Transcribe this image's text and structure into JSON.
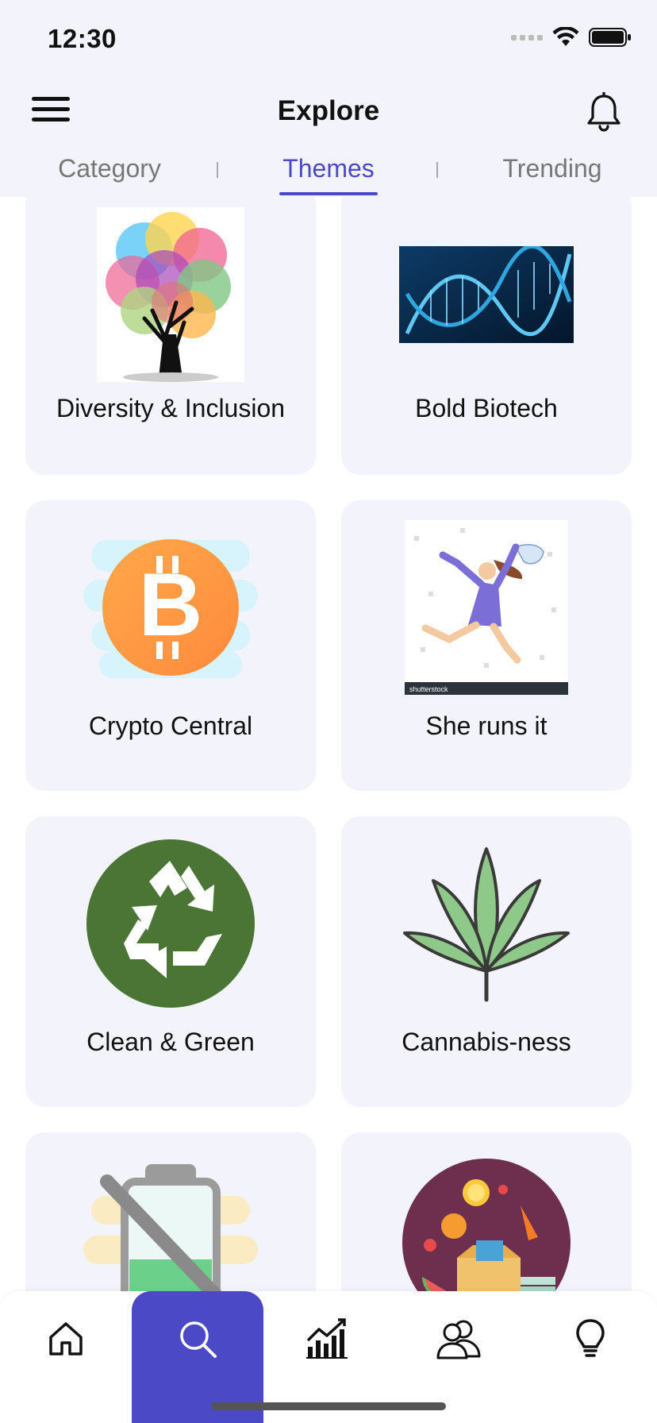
{
  "status_bar": {
    "time": "12:30"
  },
  "header": {
    "title": "Explore"
  },
  "tabs": [
    {
      "label": "Category",
      "active": false
    },
    {
      "label": "Themes",
      "active": true
    },
    {
      "label": "Trending",
      "active": false
    }
  ],
  "themes": [
    {
      "label": "Diversity & Inclusion",
      "icon": "fingerprint-tree"
    },
    {
      "label": "Bold Biotech",
      "icon": "dna-helix"
    },
    {
      "label": "Crypto Central",
      "icon": "bitcoin-coin"
    },
    {
      "label": "She runs it",
      "icon": "running-woman"
    },
    {
      "label": "Clean & Green",
      "icon": "recycle-symbol"
    },
    {
      "label": "Cannabis-ness",
      "icon": "cannabis-leaf"
    },
    {
      "label": "",
      "icon": "low-battery"
    },
    {
      "label": "",
      "icon": "food-box"
    }
  ],
  "bottom_nav": [
    {
      "icon": "home-icon",
      "active": false
    },
    {
      "icon": "search-icon",
      "active": true
    },
    {
      "icon": "chart-icon",
      "active": false
    },
    {
      "icon": "people-icon",
      "active": false
    },
    {
      "icon": "lightbulb-icon",
      "active": false
    }
  ],
  "colors": {
    "accent": "#4b49c6",
    "card_bg": "#f3f3fb",
    "header_bg": "#f3f3fb"
  }
}
